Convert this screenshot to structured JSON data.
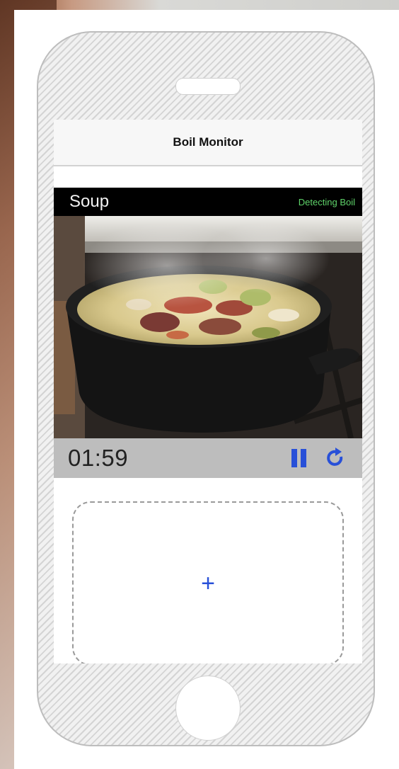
{
  "navbar": {
    "title": "Boil Monitor"
  },
  "monitor": {
    "name": "Soup",
    "status": "Detecting Boil",
    "timer": "01:59"
  },
  "controls": {
    "pause_icon": "pause-icon",
    "restart_icon": "restart-icon"
  },
  "add_card": {
    "label": "+"
  },
  "colors": {
    "accent": "#2850d8",
    "status_green": "#5fd36a",
    "controls_bar": "#bdbdbd"
  }
}
